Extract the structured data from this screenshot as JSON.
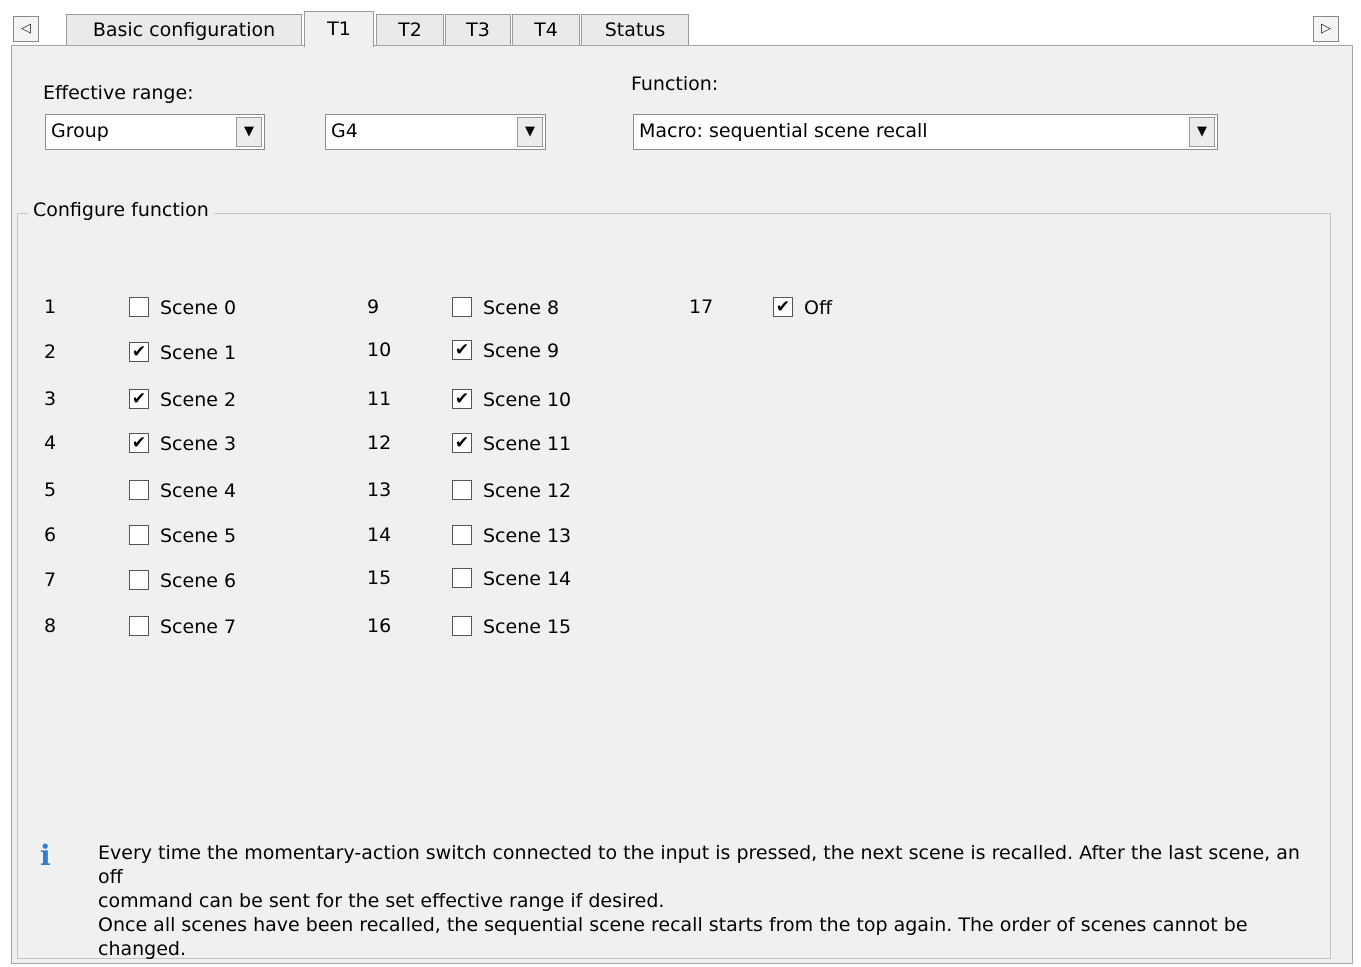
{
  "tabs": {
    "scroll_left": "◁",
    "scroll_right": "▷",
    "items": [
      {
        "label": "Basic configuration",
        "active": false
      },
      {
        "label": "T1",
        "active": true
      },
      {
        "label": "T2",
        "active": false
      },
      {
        "label": "T3",
        "active": false
      },
      {
        "label": "T4",
        "active": false
      },
      {
        "label": "Status",
        "active": false
      }
    ]
  },
  "effective_range": {
    "label": "Effective range:",
    "type_value": "Group",
    "target_value": "G4"
  },
  "function": {
    "label": "Function:",
    "value": "Macro: sequential scene recall"
  },
  "configure": {
    "legend": "Configure function",
    "rows": [
      {
        "num": "1",
        "label": "Scene 0",
        "checked": false
      },
      {
        "num": "2",
        "label": "Scene 1",
        "checked": true
      },
      {
        "num": "3",
        "label": "Scene 2",
        "checked": true
      },
      {
        "num": "4",
        "label": "Scene 3",
        "checked": true
      },
      {
        "num": "5",
        "label": "Scene 4",
        "checked": false
      },
      {
        "num": "6",
        "label": "Scene 5",
        "checked": false
      },
      {
        "num": "7",
        "label": "Scene 6",
        "checked": false
      },
      {
        "num": "8",
        "label": "Scene 7",
        "checked": false
      },
      {
        "num": "9",
        "label": "Scene 8",
        "checked": false
      },
      {
        "num": "10",
        "label": "Scene 9",
        "checked": true
      },
      {
        "num": "11",
        "label": "Scene 10",
        "checked": true
      },
      {
        "num": "12",
        "label": "Scene 11",
        "checked": true
      },
      {
        "num": "13",
        "label": "Scene 12",
        "checked": false
      },
      {
        "num": "14",
        "label": "Scene 13",
        "checked": false
      },
      {
        "num": "15",
        "label": "Scene 14",
        "checked": false
      },
      {
        "num": "16",
        "label": "Scene 15",
        "checked": false
      },
      {
        "num": "17",
        "label": "Off",
        "checked": true
      }
    ]
  },
  "info": {
    "icon": "info-icon",
    "line1": "Every time the momentary-action switch connected to the input is pressed, the next scene is recalled. After the last scene, an off",
    "line2": "command can be sent for the set effective range if desired.",
    "line3": "Once all scenes have been recalled, the sequential scene recall starts from the top again. The order of scenes cannot be changed."
  },
  "colors": {
    "panel_bg": "#f0f0f0",
    "info_icon": "#2b7fd1"
  }
}
